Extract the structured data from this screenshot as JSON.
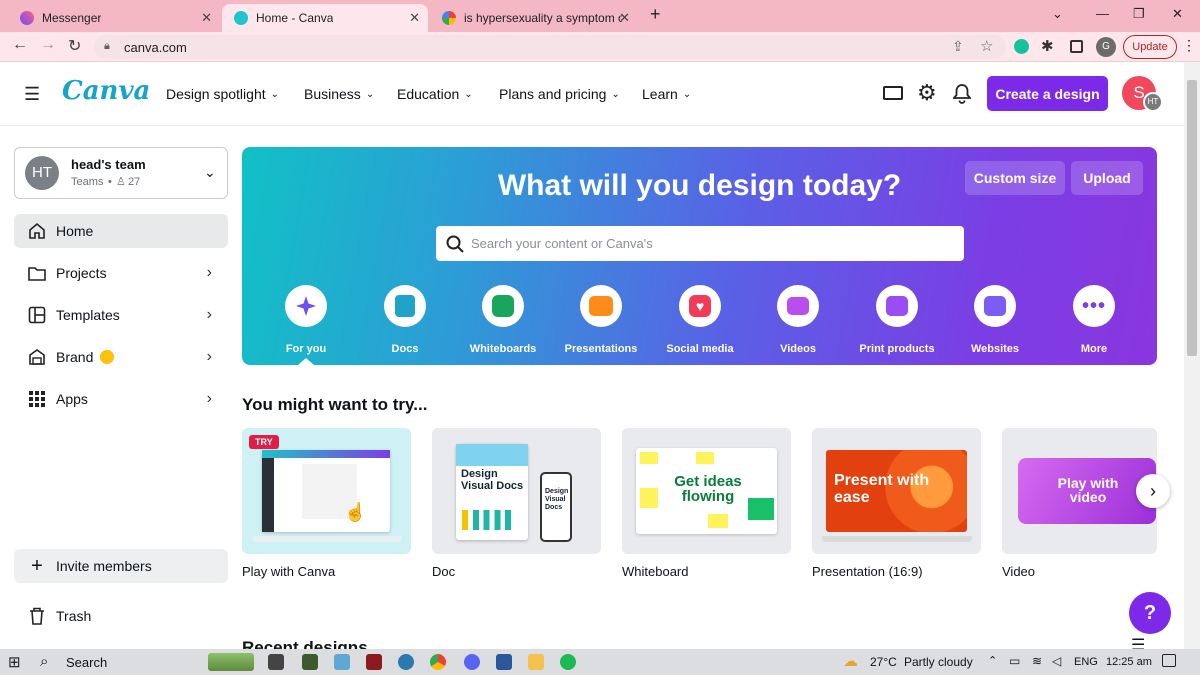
{
  "browser": {
    "tabs": [
      {
        "label": "Messenger",
        "active": false
      },
      {
        "label": "Home - Canva",
        "active": true
      },
      {
        "label": "is hypersexuality a symptom of b",
        "active": false
      }
    ],
    "new_tab": "+",
    "url": "canva.com",
    "update_label": "Update",
    "profile_initial": "G"
  },
  "header": {
    "logo": "Canva",
    "menu": [
      {
        "label": "Design spotlight"
      },
      {
        "label": "Business"
      },
      {
        "label": "Education"
      },
      {
        "label": "Plans and pricing"
      },
      {
        "label": "Learn"
      }
    ],
    "create_label": "Create a design",
    "avatar_initial": "S",
    "avatar_badge": "HT"
  },
  "sidebar": {
    "team_initials": "HT",
    "team_name": "head's team",
    "team_type": "Teams",
    "team_count": "27",
    "items": [
      {
        "label": "Home"
      },
      {
        "label": "Projects"
      },
      {
        "label": "Templates"
      },
      {
        "label": "Brand"
      },
      {
        "label": "Apps"
      }
    ],
    "invite_label": "Invite members",
    "trash_label": "Trash"
  },
  "hero": {
    "title": "What will you design today?",
    "custom_size": "Custom size",
    "upload": "Upload",
    "search_placeholder": "Search your content or Canva's",
    "categories": [
      {
        "label": "For you",
        "icon": "sparkle-icon",
        "color": "#6e4ff6"
      },
      {
        "label": "Docs",
        "icon": "doc-icon",
        "color": "#1fa3c9"
      },
      {
        "label": "Whiteboards",
        "icon": "whiteboard-icon",
        "color": "#18a65f"
      },
      {
        "label": "Presentations",
        "icon": "presentation-icon",
        "color": "#ff8c1a"
      },
      {
        "label": "Social media",
        "icon": "heart-icon",
        "color": "#f23b57"
      },
      {
        "label": "Videos",
        "icon": "video-icon",
        "color": "#b84ef0"
      },
      {
        "label": "Print products",
        "icon": "printer-icon",
        "color": "#9b4cf2"
      },
      {
        "label": "Websites",
        "icon": "website-icon",
        "color": "#7b5cf5"
      },
      {
        "label": "More",
        "icon": "more-icon",
        "color": "#7b3fe4"
      }
    ]
  },
  "suggestions": {
    "heading": "You might want to try...",
    "cards": [
      {
        "label": "Play with Canva",
        "badge": "TRY"
      },
      {
        "label": "Doc",
        "thumb_text": "Design Visual Docs",
        "thumb_text_small": "Design Visual Docs"
      },
      {
        "label": "Whiteboard",
        "thumb_text": "Get ideas flowing"
      },
      {
        "label": "Presentation (16:9)",
        "thumb_text": "Present with ease"
      },
      {
        "label": "Video",
        "thumb_text": "Play with video"
      }
    ]
  },
  "recent_heading": "Recent designs",
  "help_label": "?",
  "taskbar": {
    "search_label": "Search",
    "temperature": "27°C",
    "weather": "Partly cloudy",
    "language": "ENG",
    "time": "12:25 am"
  },
  "colors": {
    "accent": "#7d2ae8",
    "tabbar": "#f4b8c4"
  }
}
